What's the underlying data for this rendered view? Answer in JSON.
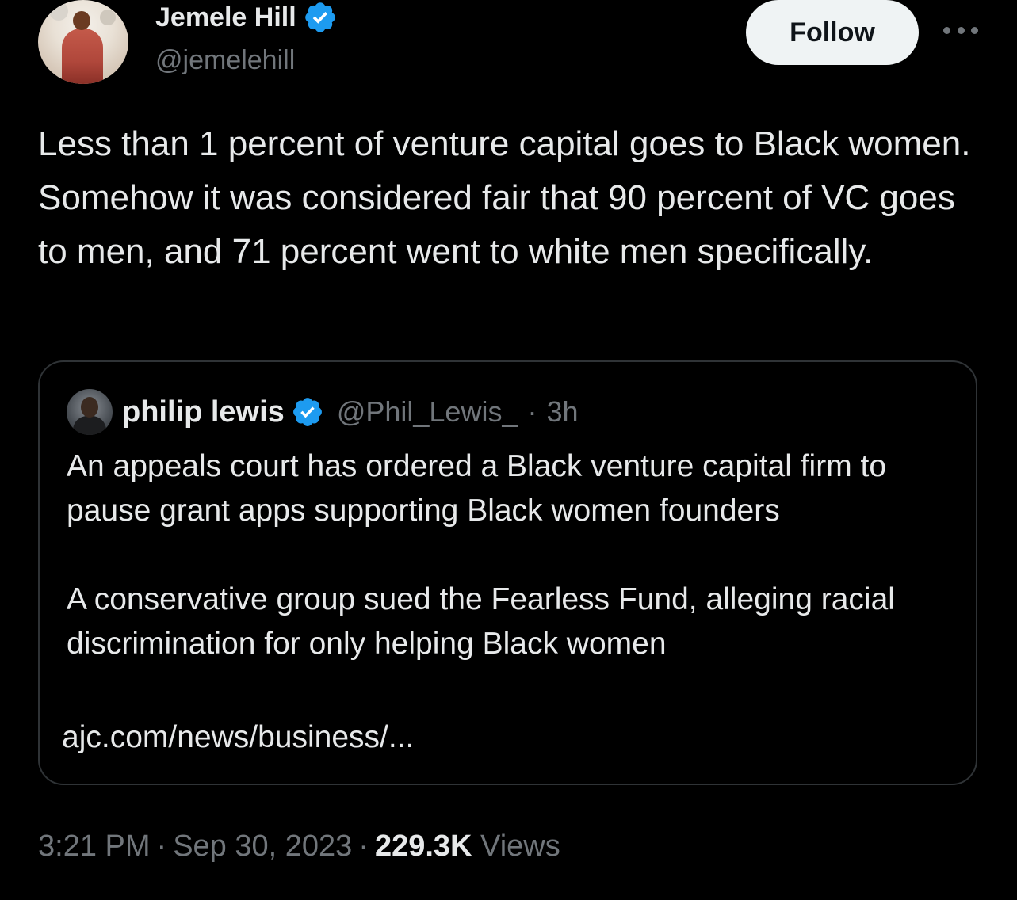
{
  "tweet": {
    "author": {
      "name": "Jemele Hill",
      "handle": "@jemelehill",
      "verified": true
    },
    "follow_label": "Follow",
    "more_icon": "more-horizontal-icon",
    "text": "Less than 1 percent of venture capital goes to Black women. Somehow it was considered fair that 90 percent of VC goes to men, and 71 percent went to white men specifically.",
    "quote": {
      "name": "philip lewis",
      "handle": "@Phil_Lewis_",
      "separator": "·",
      "time": "3h",
      "verified": true,
      "paragraph1": "An appeals court has ordered a Black venture capital firm to pause grant apps supporting Black women founders",
      "paragraph2": "A conservative group sued the Fearless Fund, alleging racial discrimination for only helping Black women",
      "link": "ajc.com/news/business/..."
    },
    "meta": {
      "time": "3:21 PM",
      "separator": "·",
      "date": "Sep 30, 2023",
      "views_count": "229.3K",
      "views_label": "Views"
    }
  },
  "colors": {
    "background": "#000000",
    "text_primary": "#e7e9ea",
    "text_secondary": "#71767b",
    "verified_blue": "#1d9bf0",
    "border": "#2f3336",
    "follow_bg": "#eff3f4"
  }
}
